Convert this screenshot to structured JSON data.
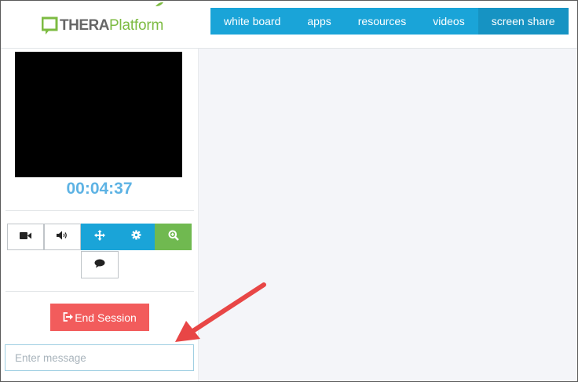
{
  "header": {
    "logo": {
      "part1": "THERA",
      "part2": "Platform"
    },
    "nav": [
      {
        "label": "white board"
      },
      {
        "label": "apps"
      },
      {
        "label": "resources"
      },
      {
        "label": "videos"
      },
      {
        "label": "screen share"
      }
    ],
    "active_nav": "screen share"
  },
  "session": {
    "timer": "00:04:37",
    "controls": [
      {
        "icon": "video-camera-icon"
      },
      {
        "icon": "speaker-icon"
      },
      {
        "icon": "move-arrows-icon"
      },
      {
        "icon": "gear-icon"
      },
      {
        "icon": "zoom-in-icon"
      },
      {
        "icon": "chat-bubble-icon"
      }
    ],
    "end_label": "End Session",
    "end_icon": "sign-out-icon"
  },
  "chat": {
    "placeholder": "Enter message",
    "value": ""
  },
  "annotation": {
    "arrow_color": "#e84646"
  },
  "colors": {
    "nav_bg": "#1aa4d8",
    "nav_active": "#1693c3",
    "timer": "#5eb3e4",
    "end_button": "#f25c5c",
    "zoom_button": "#70b950",
    "logo_green": "#7dbb42"
  }
}
